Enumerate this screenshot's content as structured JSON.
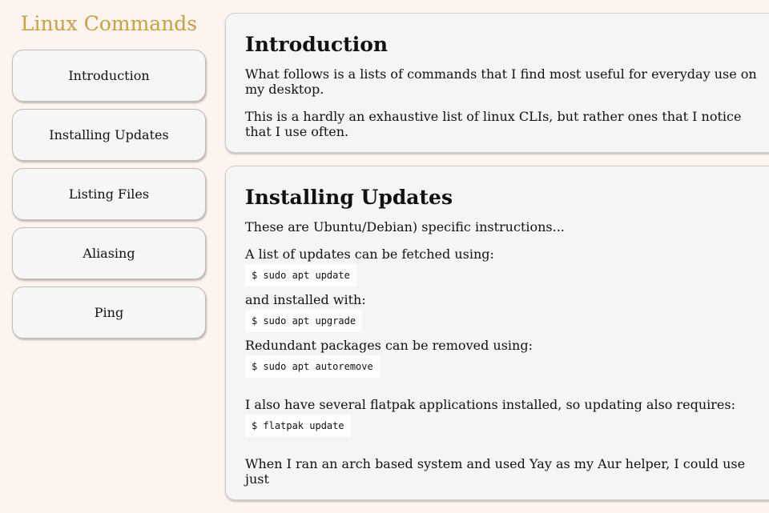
{
  "sidebar": {
    "title": "Linux Commands",
    "items": [
      {
        "label": "Introduction"
      },
      {
        "label": "Installing Updates"
      },
      {
        "label": "Listing Files"
      },
      {
        "label": "Aliasing"
      },
      {
        "label": "Ping"
      }
    ]
  },
  "intro": {
    "heading": "Introduction",
    "p1": "What follows is a lists of commands that I find most useful for everyday use on my desktop.",
    "p2": "This is a hardly an exhaustive list of linux CLIs, but rather ones that I notice that I use often."
  },
  "updates": {
    "heading": "Installing Updates",
    "p1": "These are Ubuntu/Debian) specific instructions...",
    "fetch_text": "A list of updates can be fetched using:",
    "fetch_cmd": "$ sudo apt update",
    "install_text": "and installed with:",
    "install_cmd": "$ sudo apt upgrade",
    "remove_text": "Redundant packages can be removed using:",
    "remove_cmd": "$ sudo apt autoremove",
    "flatpak_text": "I also have several flatpak applications installed, so updating also requires:",
    "flatpak_cmd": "$ flatpak update",
    "arch_text": "When I ran an arch based system and used Yay as my Aur helper, I could use just"
  }
}
